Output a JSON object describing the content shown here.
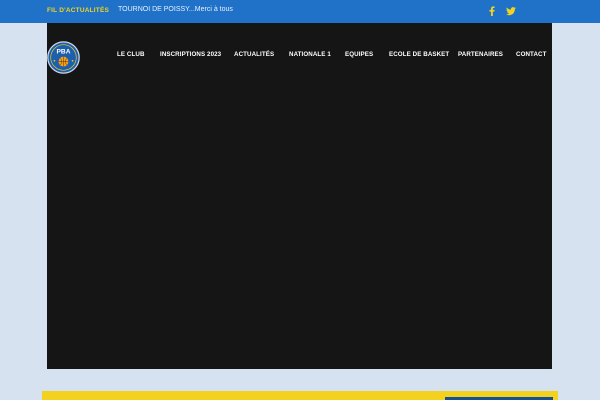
{
  "topbar": {
    "ticker_label": "FIL D'ACTUALITÉS",
    "ticker_text": "TOURNOI DE POISSY...Merci à tous",
    "social": [
      {
        "icon": "facebook-icon"
      },
      {
        "icon": "twitter-icon"
      }
    ]
  },
  "logo": {
    "text_top": "PBA",
    "icon": "basketball-logo"
  },
  "nav": {
    "items": [
      {
        "label": "LE CLUB"
      },
      {
        "label": "INSCRIPTIONS 2023"
      },
      {
        "label": "ACTUALITÉS"
      },
      {
        "label": "NATIONALE 1"
      },
      {
        "label": "EQUIPES"
      },
      {
        "label": "ECOLE DE BASKET"
      },
      {
        "label": "PARTENAIRES"
      },
      {
        "label": "CONTACT"
      }
    ]
  },
  "colors": {
    "topbar": "#1f72c7",
    "accent_yellow": "#f2d21e",
    "page_bg": "#d6e2ef",
    "stage_bg": "#151515",
    "button_blue": "#1b4f8f"
  }
}
